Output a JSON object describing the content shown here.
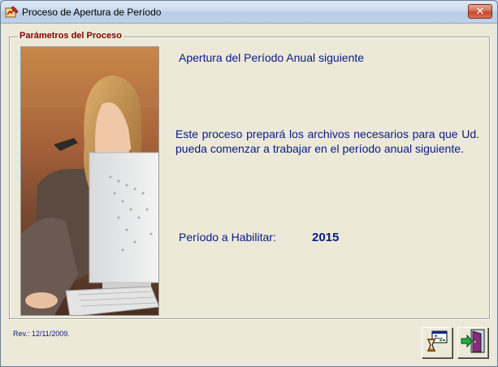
{
  "window": {
    "title": "Proceso de Apertura de Período"
  },
  "group": {
    "legend": "Parámetros del Proceso"
  },
  "content": {
    "heading": "Apertura del Período Anual siguiente",
    "description": "Este proceso prepará los archivos necesarios para que Ud. pueda comenzar a trabajar en el período anual siguiente.",
    "period_label": "Período a Habilitar:",
    "period_value": "2015"
  },
  "footer": {
    "revision": "Rev.: 12/11/2009."
  },
  "icons": {
    "app": "app-icon",
    "close": "close-icon",
    "process": "process-hourglass-icon",
    "exit": "exit-door-icon"
  },
  "colors": {
    "text_accent": "#0a1a8a",
    "legend": "#800000",
    "close_button": "#c5452c"
  }
}
